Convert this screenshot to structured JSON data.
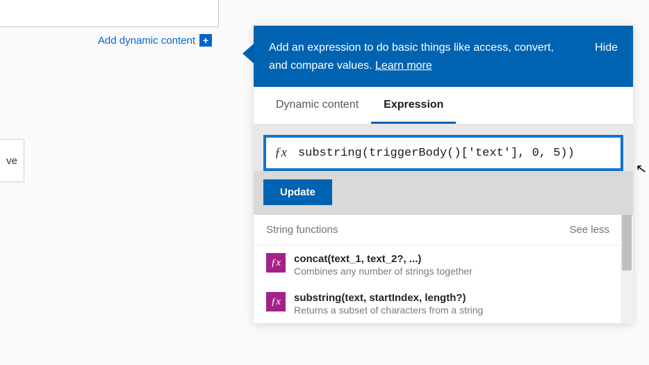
{
  "left": {
    "add_dynamic_label": "Add dynamic content",
    "partial_text": "ve"
  },
  "panel": {
    "header_text_1": "Add an expression to do basic things like access, convert, and compare values. ",
    "learn_more": "Learn more",
    "hide": "Hide",
    "tabs": {
      "dynamic": "Dynamic content",
      "expression": "Expression"
    },
    "fx_label": "ƒx",
    "expression_value": "substring(triggerBody()['text'], 0, 5))",
    "update": "Update",
    "category": "String functions",
    "see_less": "See less",
    "functions": [
      {
        "signature": "concat(text_1, text_2?, ...)",
        "description": "Combines any number of strings together"
      },
      {
        "signature": "substring(text, startIndex, length?)",
        "description": "Returns a subset of characters from a string"
      }
    ]
  }
}
